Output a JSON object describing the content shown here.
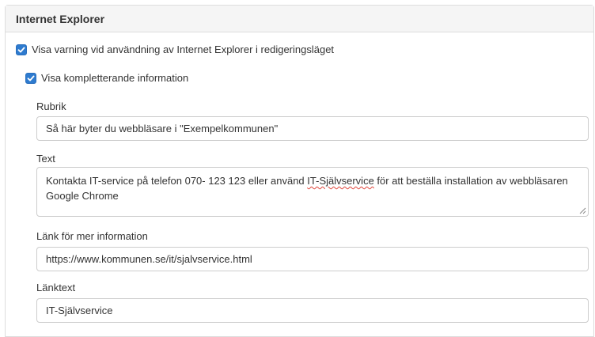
{
  "panel": {
    "title": "Internet Explorer"
  },
  "warning_checkbox": {
    "label": "Visa varning vid användning av Internet Explorer i redigeringsläget",
    "checked": true
  },
  "extra_info_checkbox": {
    "label": "Visa kompletterande information",
    "checked": true
  },
  "fields": {
    "rubrik": {
      "label": "Rubrik",
      "value": "Så här byter du webbläsare i \"Exempelkommunen\""
    },
    "text": {
      "label": "Text",
      "value_before": "Kontakta IT-service på telefon 070- 123 123 eller använd ",
      "value_misspelled": "IT-Självservice",
      "value_after": " för att beställa installation av webbläsaren Google Chrome"
    },
    "link": {
      "label": "Länk för mer information",
      "value": "https://www.kommunen.se/it/sjalvservice.html"
    },
    "link_text": {
      "label": "Länktext",
      "value": "IT-Självservice"
    }
  },
  "colors": {
    "checkbox_accent": "#2e7bcf",
    "spellcheck_underline": "#e0443a"
  }
}
